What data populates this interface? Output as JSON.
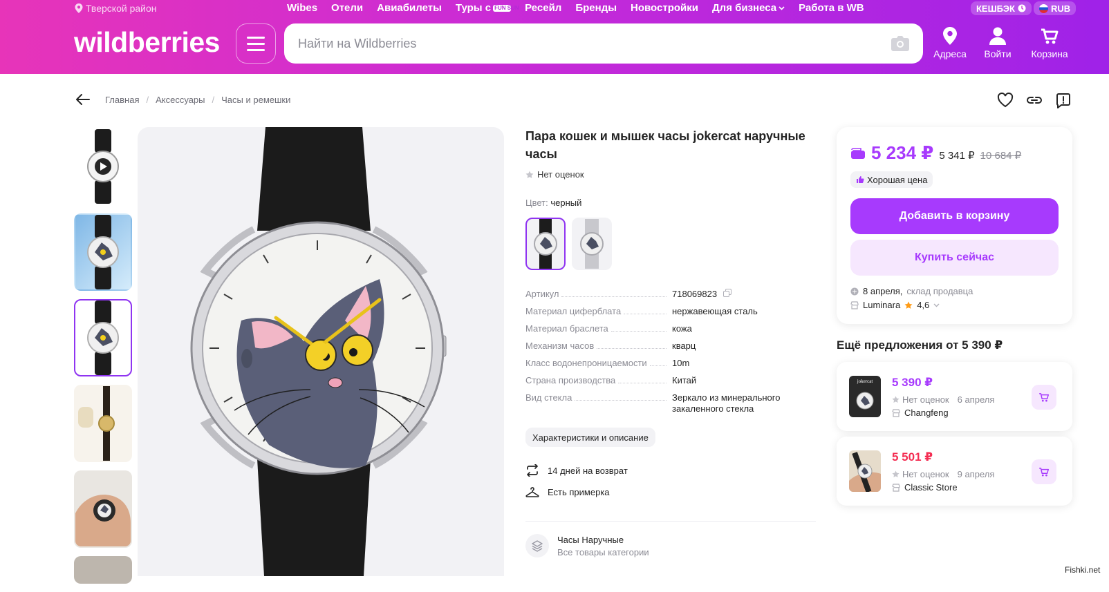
{
  "header": {
    "location": "Тверской район",
    "nav": [
      "Wibes",
      "Отели",
      "Авиабилеты",
      "Туры с",
      "Ресейл",
      "Бренды",
      "Новостройки",
      "Для бизнеса",
      "Работа в WB"
    ],
    "tours_badge": "FUN SUN",
    "cashback": "КЕШБЭК",
    "currency": "RUB",
    "logo": "wildberries",
    "search_placeholder": "Найти на Wildberries",
    "icons": {
      "addresses": "Адреса",
      "login": "Войти",
      "cart": "Корзина"
    }
  },
  "breadcrumb": [
    "Главная",
    "Аксессуары",
    "Часы и ремешки"
  ],
  "product": {
    "title": "Пара кошек и мышек часы jokercat наручные часы",
    "rating_text": "Нет оценок",
    "color_label": "Цвет:",
    "color_value": "черный",
    "specs": [
      {
        "k": "Артикул",
        "v": "718069823"
      },
      {
        "k": "Материал циферблата",
        "v": "нержавеющая сталь"
      },
      {
        "k": "Материал браслета",
        "v": "кожа"
      },
      {
        "k": "Механизм часов",
        "v": "кварц"
      },
      {
        "k": "Класс водонепроницаемости",
        "v": "10m"
      },
      {
        "k": "Страна производства",
        "v": "Китай"
      },
      {
        "k": "Вид стекла",
        "v": "Зеркало из минерального закаленного стекла"
      }
    ],
    "chars_button": "Характеристики и описание",
    "return_text": "14 дней на возврат",
    "fitting_text": "Есть примерка",
    "category_title": "Часы Наручные",
    "category_sub": "Все товары категории"
  },
  "price": {
    "main": "5 234 ₽",
    "mid": "5 341 ₽",
    "old": "10 684 ₽",
    "good_price": "Хорошая цена",
    "add_to_cart": "Добавить в корзину",
    "buy_now": "Купить сейчас",
    "delivery_date": "8 апреля,",
    "delivery_from": "склад продавца",
    "seller": "Luminara",
    "seller_rating": "4,6"
  },
  "offers": {
    "heading": "Ещё предложения от 5 390 ₽",
    "items": [
      {
        "price": "5 390 ₽",
        "rating": "Нет оценок",
        "date": "6 апреля",
        "seller": "Changfeng",
        "thumb_brand": "jokercat"
      },
      {
        "price": "5 501 ₽",
        "rating": "Нет оценок",
        "date": "9 апреля",
        "seller": "Classic Store"
      }
    ]
  },
  "watermark": "Fishki.net",
  "colors": {
    "accent": "#a73afd",
    "red_price": "#f42d52",
    "header_from": "#e734b9",
    "header_to": "#9f22e8"
  }
}
